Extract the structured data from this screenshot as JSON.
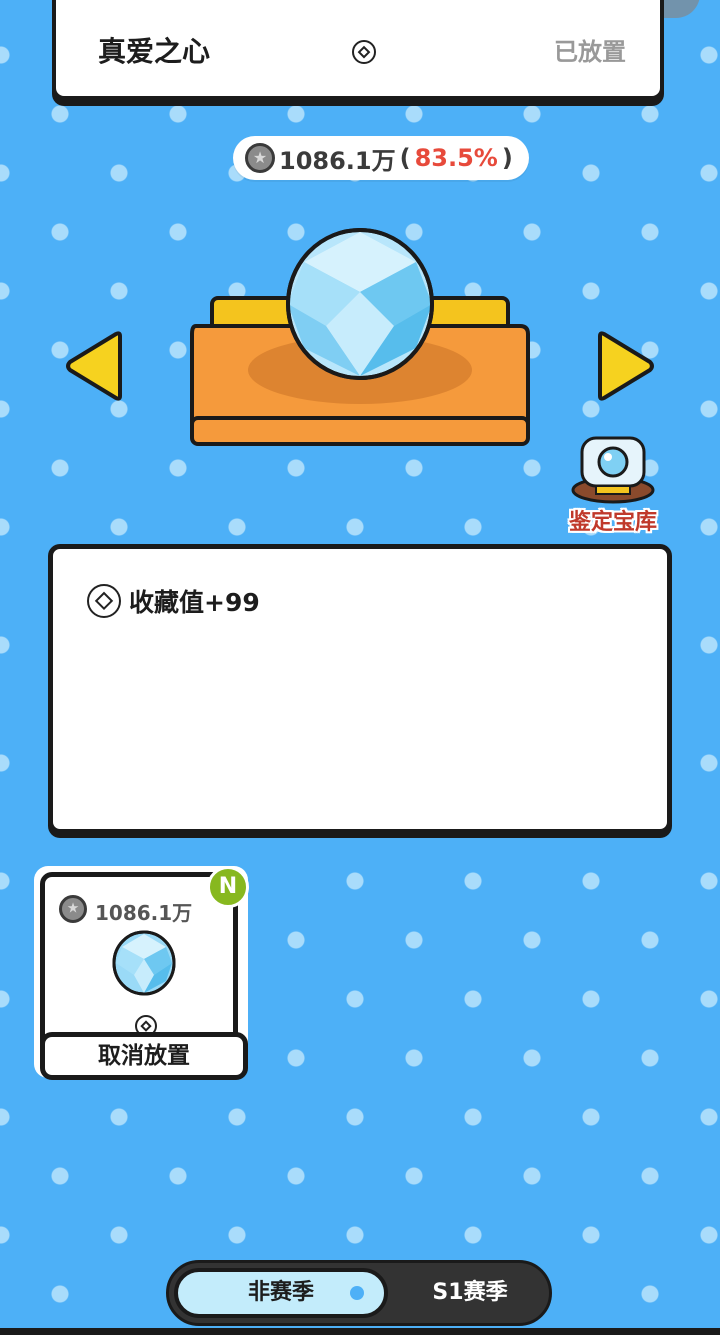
{
  "top_card": {
    "title": "真爱之心",
    "status": "已放置",
    "icon": "collection-ring-icon"
  },
  "value": {
    "amount": "1086.1万",
    "open_paren": "(",
    "percent": "83.5%",
    "close_paren": ")",
    "icon": "coin-icon"
  },
  "nav": {
    "prev_icon": "arrow-left-icon",
    "next_icon": "arrow-right-icon"
  },
  "vault": {
    "label": "鉴定宝库",
    "icon": "vault-icon"
  },
  "description": {
    "line": "收藏值+99",
    "icon": "collection-ring-icon"
  },
  "slot": {
    "price": "1086.1万",
    "badge": "N",
    "button_label": "取消放置"
  },
  "season_toggle": {
    "active": "非赛季",
    "inactive": "S1赛季"
  },
  "colors": {
    "background": "#4db0f7",
    "percent": "#e74a3b",
    "badge": "#87b81f",
    "vault_label": "#c0392b"
  }
}
